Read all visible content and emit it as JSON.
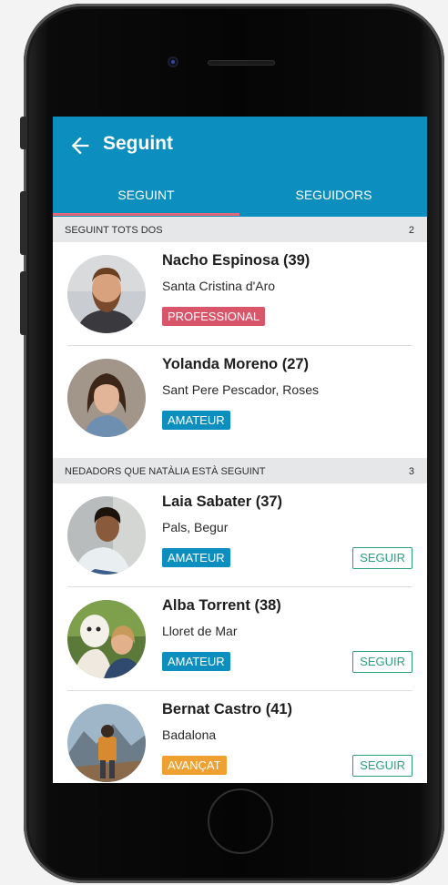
{
  "header": {
    "title": "Seguint"
  },
  "tabs": [
    {
      "label": "SEGUINT",
      "active": true
    },
    {
      "label": "SEGUIDORS",
      "active": false
    }
  ],
  "sections": [
    {
      "title": "SEGUINT TOTS DOS",
      "count": "2",
      "items": [
        {
          "name": "Nacho Espinosa (39)",
          "location": "Santa Cristina d'Aro",
          "level": "PROFESSIONAL",
          "level_color": "#d9566a"
        },
        {
          "name": "Yolanda Moreno (27)",
          "location": "Sant Pere Pescador, Roses",
          "level": "AMATEUR",
          "level_color": "#0c8fbf"
        }
      ]
    },
    {
      "title": "NEDADORS QUE NATÀLIA ESTÀ SEGUINT",
      "count": "3",
      "items": [
        {
          "name": "Laia Sabater (37)",
          "location": "Pals, Begur",
          "level": "AMATEUR",
          "level_color": "#0c8fbf",
          "action": "SEGUIR"
        },
        {
          "name": "Alba Torrent (38)",
          "location": "Lloret de Mar",
          "level": "AMATEUR",
          "level_color": "#0c8fbf",
          "action": "SEGUIR"
        },
        {
          "name": "Bernat Castro (41)",
          "location": "Badalona",
          "level": "AVANÇAT",
          "level_color": "#f0a030",
          "action": "SEGUIR"
        }
      ]
    }
  ],
  "colors": {
    "appbar": "#0c8fbf",
    "tab_indicator": "#e06a78",
    "follow": "#2aa17e"
  }
}
